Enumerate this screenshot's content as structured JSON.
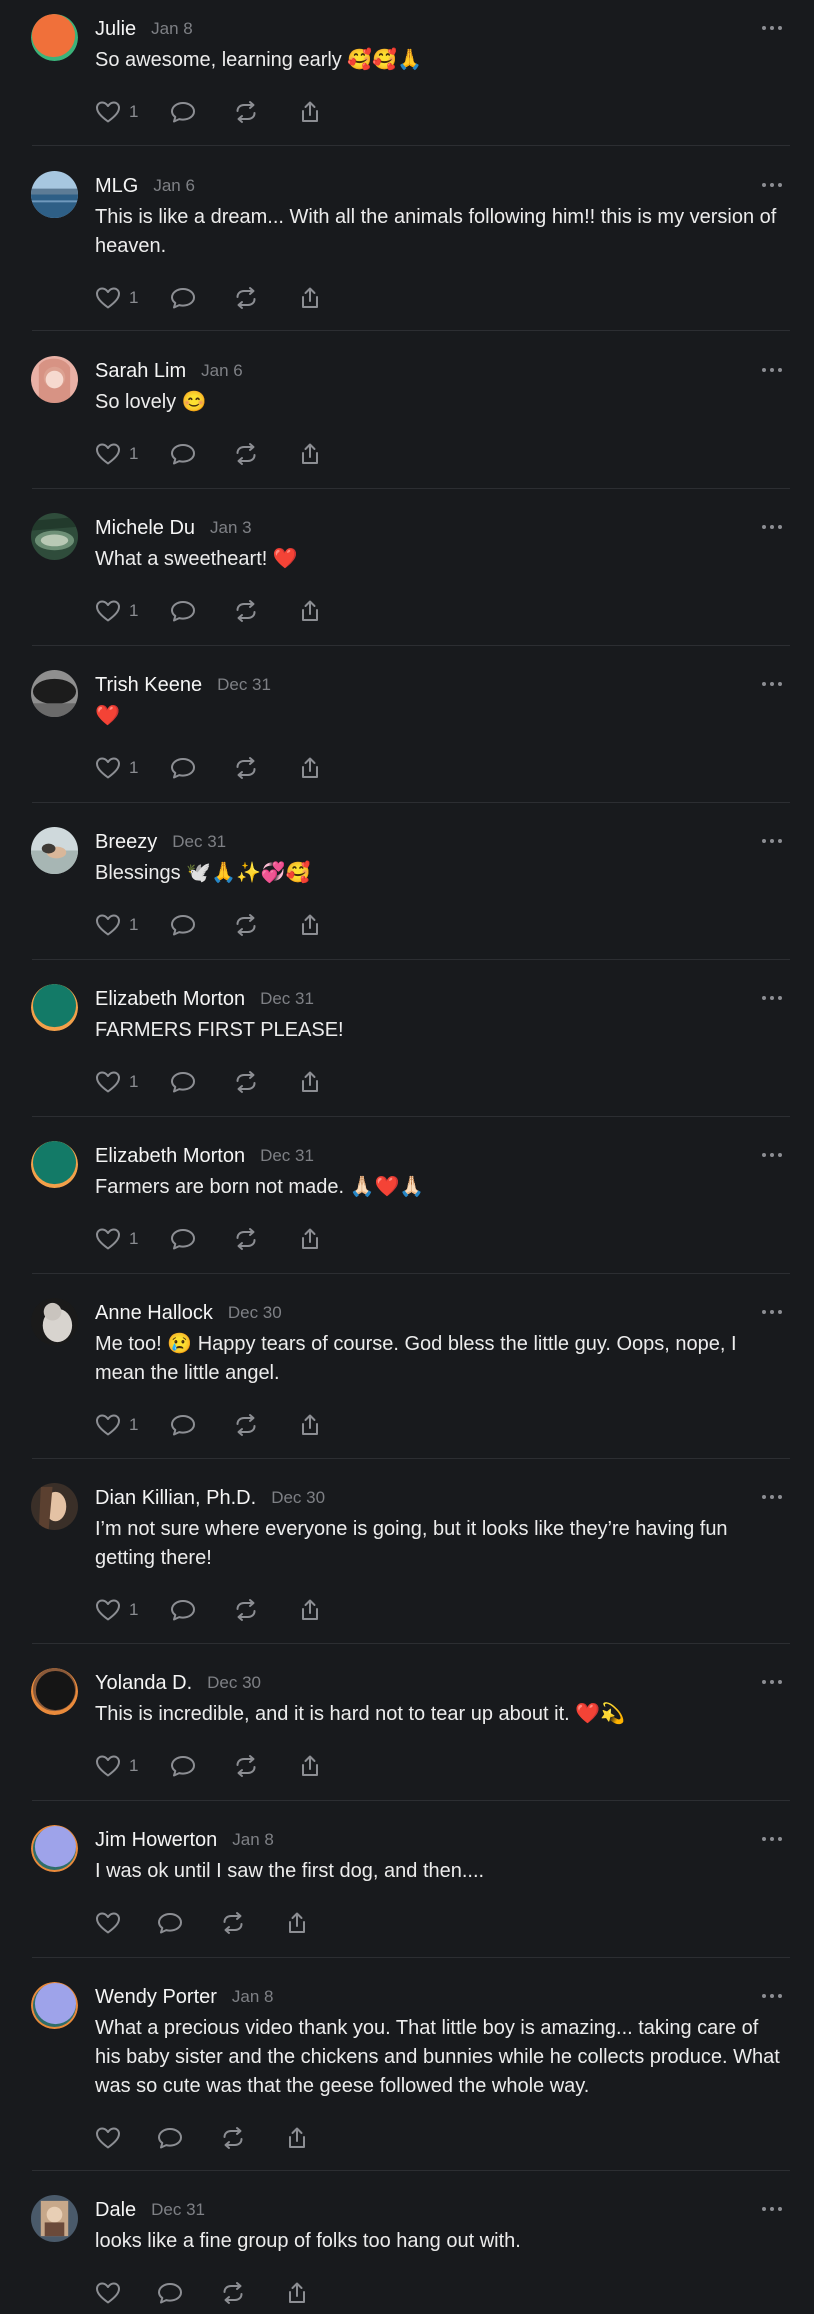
{
  "colors": {
    "background": "#181a1d",
    "text": "#f2f2f2",
    "muted": "#7e8085",
    "divider": "#2c2e32",
    "icon": "#8c8e93"
  },
  "icons": {
    "more": "more-horizontal-icon",
    "like": "heart-icon",
    "reply": "comment-icon",
    "repost": "repost-icon",
    "share": "share-icon"
  },
  "comments": [
    {
      "author": "Julie",
      "date": "Jan 8",
      "text": "So awesome, learning early 🥰🥰🙏",
      "likes": "1",
      "avatar": "orange"
    },
    {
      "author": "MLG",
      "date": "Jan 6",
      "text": "This is like a dream... With all the animals following him!! this is my version of heaven.",
      "likes": "1",
      "avatar": "lake"
    },
    {
      "author": "Sarah Lim",
      "date": "Jan 6",
      "text": "So lovely 😊",
      "likes": "1",
      "avatar": "pink"
    },
    {
      "author": "Michele Du",
      "date": "Jan 3",
      "text": "What a sweetheart! ❤️",
      "likes": "1",
      "avatar": "green"
    },
    {
      "author": "Trish Keene",
      "date": "Dec 31",
      "text": "❤️",
      "likes": "1",
      "avatar": "dark"
    },
    {
      "author": "Breezy",
      "date": "Dec 31",
      "text": "Blessings 🕊️🙏✨💞🥰",
      "likes": "1",
      "avatar": "beach"
    },
    {
      "author": "Elizabeth Morton",
      "date": "Dec 31",
      "text": "FARMERS FIRST PLEASE!",
      "likes": "1",
      "avatar": "teal"
    },
    {
      "author": "Elizabeth Morton",
      "date": "Dec 31",
      "text": "Farmers are born not made. 🙏🏻❤️🙏🏻",
      "likes": "1",
      "avatar": "teal"
    },
    {
      "author": "Anne Hallock",
      "date": "Dec 30",
      "text": "Me too! 😢 Happy tears of course. God bless the little guy. Oops, nope, I mean the little angel.",
      "likes": "1",
      "avatar": "cat"
    },
    {
      "author": "Dian Killian, Ph.D.",
      "date": "Dec 30",
      "text": "I’m not sure where everyone is going, but it looks like they’re having fun getting there!",
      "likes": "1",
      "avatar": "portrait"
    },
    {
      "author": "Yolanda D.",
      "date": "Dec 30",
      "text": "This is incredible, and it is hard not to tear up about it. ❤️💫",
      "likes": "1",
      "avatar": "black"
    },
    {
      "author": "Jim Howerton",
      "date": "Jan 8",
      "text": "I was ok until I saw the first dog, and then....",
      "likes": "",
      "avatar": "lavender"
    },
    {
      "author": "Wendy Porter",
      "date": "Jan 8",
      "text": "What a precious video thank you. That little boy is amazing... taking care of his baby sister and the chickens and bunnies while he collects produce. What was so cute was that the geese followed the whole way.",
      "likes": "",
      "avatar": "lavender"
    },
    {
      "author": "Dale",
      "date": "Dec 31",
      "text": "looks like a fine group of folks too hang out with.",
      "likes": "",
      "avatar": "photo"
    }
  ]
}
